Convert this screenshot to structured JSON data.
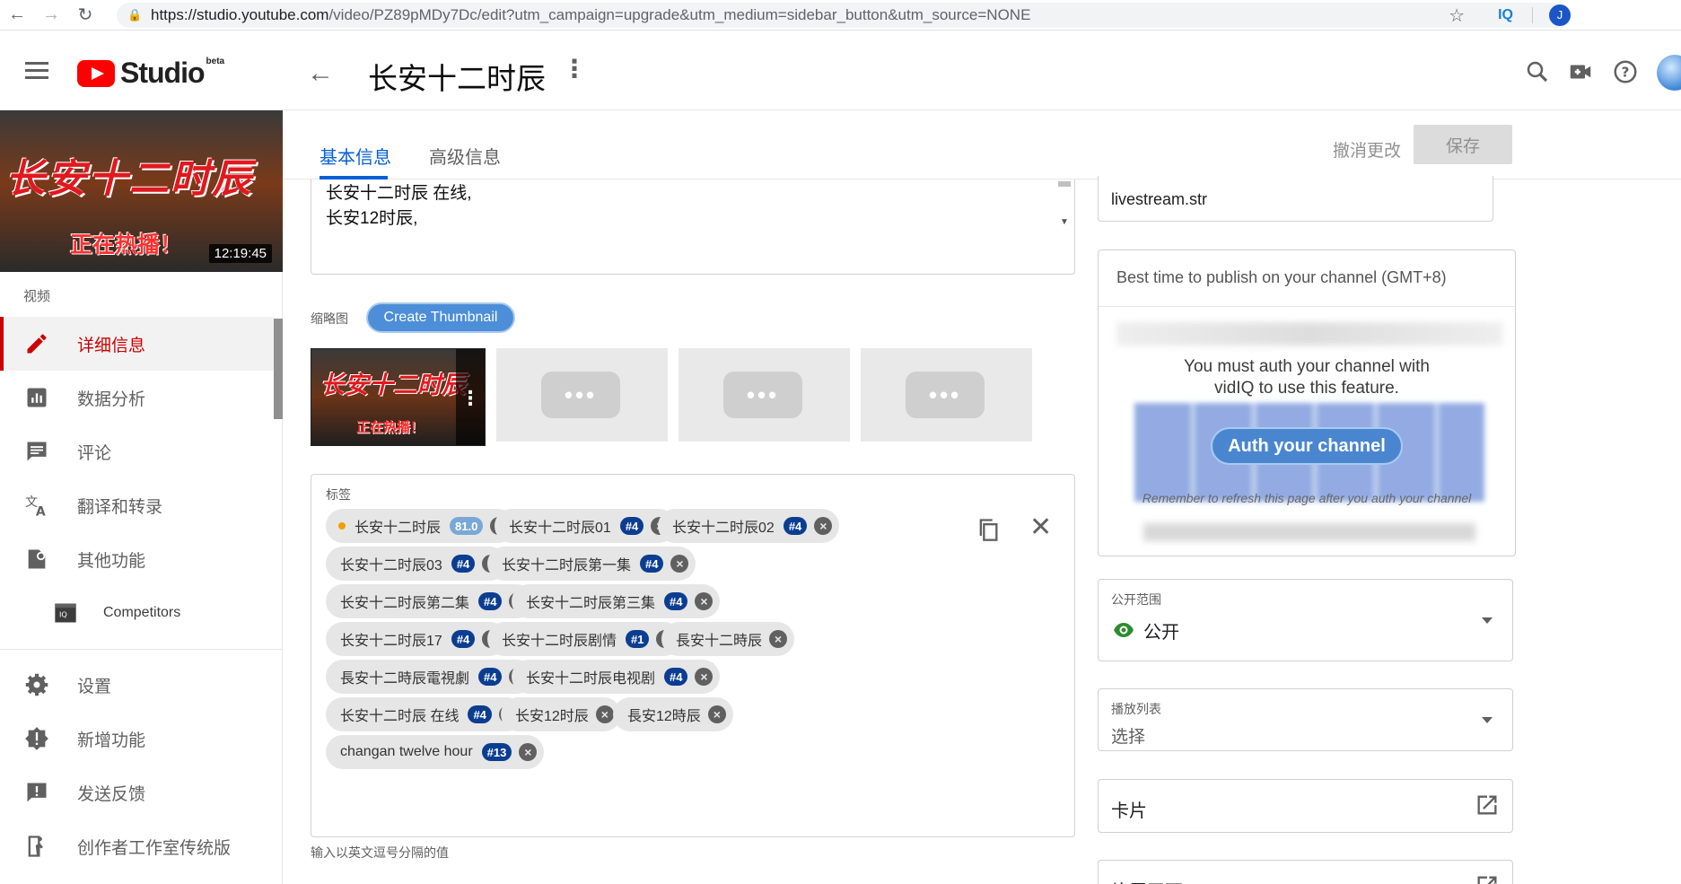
{
  "browser": {
    "url_main": "https://studio.youtube.com",
    "url_rest": "/video/PZ89pMDy7Dc/edit?utm_campaign=upgrade&utm_medium=sidebar_button&utm_source=NONE",
    "ext_label": "IQ",
    "profile_initial": "J"
  },
  "header": {
    "logo_text": "Studio",
    "logo_badge": "beta",
    "video_title": "长安十二时辰"
  },
  "sidebar": {
    "thumb_title": "长安十二时辰",
    "thumb_subtitle": "正在热播！",
    "duration": "12:19:45",
    "section_label": "视频",
    "items": [
      {
        "label": "详细信息",
        "icon": "pencil-icon"
      },
      {
        "label": "数据分析",
        "icon": "analytics-icon"
      },
      {
        "label": "评论",
        "icon": "comment-icon"
      },
      {
        "label": "翻译和转录",
        "icon": "translate-icon"
      },
      {
        "label": "其他功能",
        "icon": "extras-icon"
      },
      {
        "label": "Competitors",
        "icon": "vidiq-icon"
      },
      {
        "label": "设置",
        "icon": "gear-icon"
      },
      {
        "label": "新增功能",
        "icon": "new-badge-icon"
      },
      {
        "label": "发送反馈",
        "icon": "feedback-icon"
      },
      {
        "label": "创作者工作室传统版",
        "icon": "classic-studio-icon"
      }
    ]
  },
  "tabs": {
    "basic": "基本信息",
    "advanced": "高级信息",
    "undo": "撤消更改",
    "save": "保存"
  },
  "description": {
    "lines": [
      "长安十二时辰 在线,",
      "长安12时辰,"
    ]
  },
  "thumbnail": {
    "label": "缩略图",
    "create_button": "Create Thumbnail",
    "selected_title": "长安十二时辰",
    "selected_subtitle": "正在热播！",
    "placeholder_glyph": "•••"
  },
  "tags": {
    "label": "标签",
    "hint": "输入以英文逗号分隔的值",
    "items": [
      {
        "text": "长安十二时辰",
        "badge": "81.0"
      },
      {
        "text": "长安十二时辰01",
        "badge": "#4"
      },
      {
        "text": "长安十二时辰02",
        "badge": "#4"
      },
      {
        "text": "长安十二时辰03",
        "badge": "#4"
      },
      {
        "text": "长安十二时辰第一集",
        "badge": "#4"
      },
      {
        "text": "长安十二时辰第二集",
        "badge": "#4"
      },
      {
        "text": "长安十二时辰第三集",
        "badge": "#4"
      },
      {
        "text": "长安十二时辰17",
        "badge": "#4"
      },
      {
        "text": "长安十二时辰剧情",
        "badge": "#1"
      },
      {
        "text": "長安十二時辰",
        "badge": ""
      },
      {
        "text": "長安十二時辰電視劇",
        "badge": "#4"
      },
      {
        "text": "长安十二时辰电视剧",
        "badge": "#4"
      },
      {
        "text": "长安十二时辰 在线",
        "badge": "#4"
      },
      {
        "text": "长安12时辰",
        "badge": ""
      },
      {
        "text": "長安12時辰",
        "badge": ""
      },
      {
        "text": "changan twelve hour",
        "badge": "#13"
      }
    ]
  },
  "right": {
    "livestream_value": "livestream.str",
    "best_time_title": "Best time to publish on your channel (GMT+8)",
    "auth_message_1": "You must auth your channel with",
    "auth_message_2": "vidIQ to use this feature.",
    "auth_button": "Auth your channel",
    "auth_note": "Remember to refresh this page after you auth your channel",
    "visibility_label": "公开范围",
    "visibility_value": "公开",
    "playlist_label": "播放列表",
    "playlist_value": "选择",
    "cards_label": "卡片",
    "end_screen_label": "片尾画面"
  },
  "colors": {
    "accent_blue": "#065fd4",
    "active_red": "#cc0000",
    "badge_navy": "#0b3d91",
    "vidiq_blue": "#4a86d0"
  }
}
